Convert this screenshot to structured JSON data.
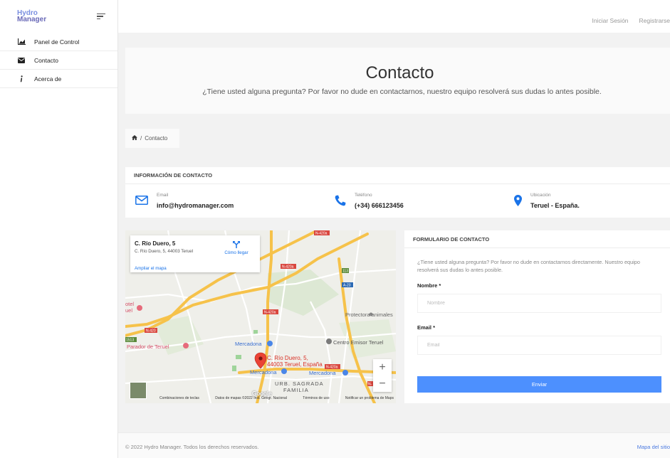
{
  "brand": {
    "line1": "Hydro",
    "line2": "Manager"
  },
  "sidebar": {
    "items": [
      {
        "label": "Panel de Control",
        "icon": "chart-icon"
      },
      {
        "label": "Contacto",
        "icon": "envelope-icon"
      },
      {
        "label": "Acerca de",
        "icon": "info-icon"
      }
    ]
  },
  "topbar": {
    "login": "Iniciar Sesión",
    "register": "Registrarse"
  },
  "hero": {
    "title": "Contacto",
    "subtitle": "¿Tiene usted alguna pregunta? Por favor no dude en contactarnos, nuestro equipo resolverá sus dudas lo antes posible."
  },
  "breadcrumb": {
    "separator": "/",
    "current": "Contacto"
  },
  "contact_info": {
    "header": "INFORMACIÓN DE CONTACTO",
    "email": {
      "caption": "Email",
      "value": "info@hydromanager.com"
    },
    "phone": {
      "caption": "Teléfono",
      "value": "(+34) 666123456"
    },
    "location": {
      "caption": "Ubicación",
      "value": "Teruel - España."
    }
  },
  "map": {
    "place_title": "C. Río Duero, 5",
    "place_address": "C. Río Duero, 5, 44003 Teruel",
    "directions": "Cómo llegar",
    "enlarge": "Ampliar el mapa",
    "marker_label_1": "C. Río Duero, 5,",
    "marker_label_2": "44003 Teruel, España",
    "labels": {
      "protectora": "Protectora animales",
      "hotel_1": "otel",
      "hotel_2": "uel",
      "parador": "Parador de Teruel",
      "mercadona_1": "Mercadona",
      "mercadona_2": "Mercadona",
      "mercadona_3": "Mercadona",
      "centro": "Centro Emisor Teruel",
      "urb_1": "URB. SAGRADA",
      "urb_2": "FAMILIA",
      "road_n420a_1": "N-420a",
      "road_n420a_2": "N-420a",
      "road_n420a_3": "N-420a",
      "road_n420a_4": "N-420a",
      "road_n420": "N-420",
      "road_a23": "A-23",
      "road_113": "113",
      "road_1513": "1513",
      "road_n": "N-"
    },
    "zoom_in": "+",
    "zoom_out": "−",
    "google": "Google",
    "attribution": {
      "shortcuts": "Combinaciones de teclas",
      "data": "Datos de mapas ©2022 Inst. Geogr. Nacional",
      "terms": "Términos de uso",
      "report": "Notificar un problema de Maps"
    }
  },
  "form": {
    "header": "FORMULARIO DE CONTACTO",
    "description": "¿Tiene usted alguna pregunta? Por favor no dude en contactarnos directamente. Nuestro equipo resolverá sus dudas lo antes posible.",
    "name_label": "Nombre *",
    "name_placeholder": "Nombre",
    "email_label": "Email *",
    "email_placeholder": "Email",
    "submit": "Enviar"
  },
  "footer": {
    "copyright": "© 2022 Hydro Manager. Todos los derechos reservados.",
    "sitemap": "Mapa del sitio"
  },
  "colors": {
    "accent": "#4d90fe",
    "link": "#1a73e8",
    "marker": "#ea4335"
  }
}
